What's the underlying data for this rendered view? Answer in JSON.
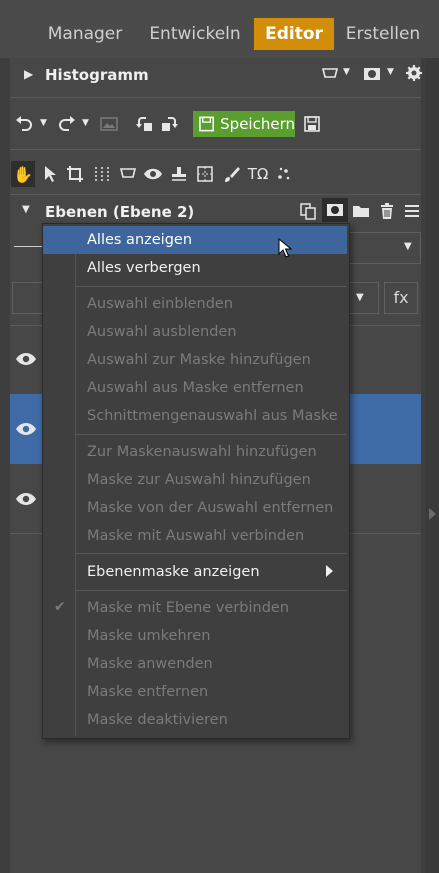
{
  "tabs": [
    "Manager",
    "Entwickeln",
    "Editor",
    "Erstellen"
  ],
  "histogram": {
    "title": "Histogramm"
  },
  "toolbar": {
    "save_label": "Speichern"
  },
  "layers": {
    "title": "Ebenen (Ebene 2)",
    "fx_label": "fx"
  },
  "menu": {
    "items": [
      "Alles anzeigen",
      "Alles verbergen",
      "Auswahl einblenden",
      "Auswahl ausblenden",
      "Auswahl zur Maske hinzufügen",
      "Auswahl aus Maske entfernen",
      "Schnittmengenauswahl aus Maske",
      "Zur Maskenauswahl hinzufügen",
      "Maske zur Auswahl hinzufügen",
      "Maske von der Auswahl entfernen",
      "Maske mit Auswahl verbinden",
      "Ebenenmaske anzeigen",
      "Maske mit Ebene verbinden",
      "Maske umkehren",
      "Maske anwenden",
      "Maske entfernen",
      "Maske deaktivieren"
    ]
  },
  "colors": {
    "accent": "#d38e09",
    "save": "#5a9e2f",
    "selection": "#3e6aa6"
  }
}
